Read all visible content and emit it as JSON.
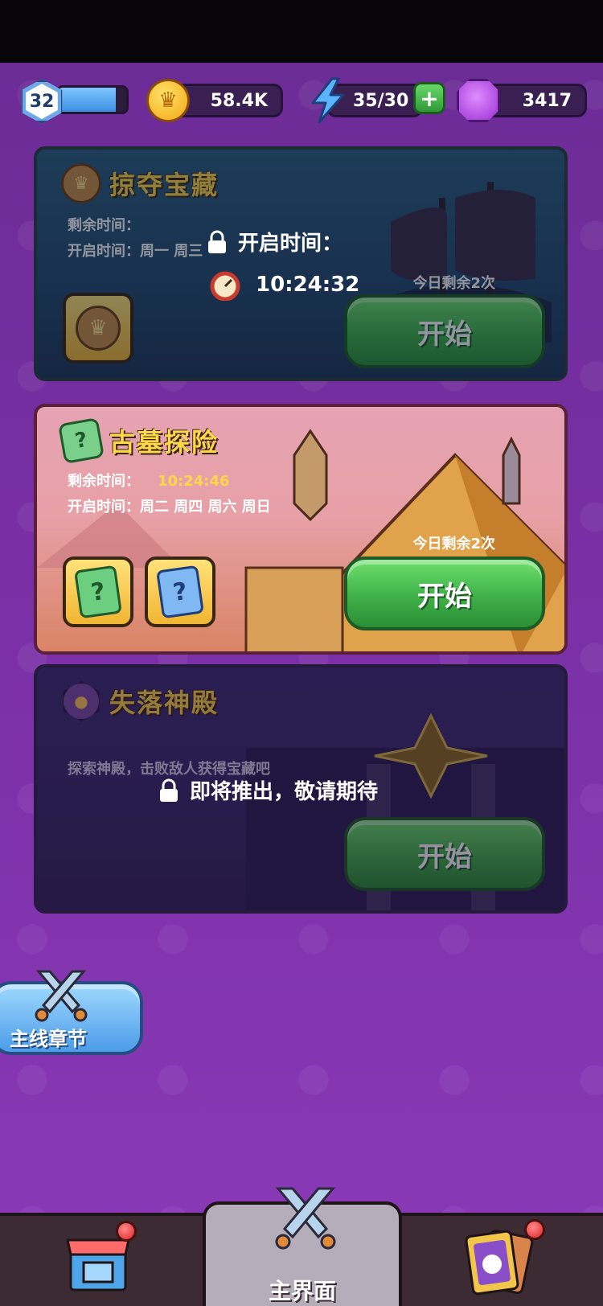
{
  "status": {
    "level": "32",
    "xp_fraction": 0.85,
    "coins": "58.4K",
    "energy": "35/30",
    "gems": "3417"
  },
  "cards": [
    {
      "title": "掠夺宝藏",
      "remaining_label": "剩余时间：",
      "open_label": "开启时间：周一 周三",
      "lock_text": "开启时间：",
      "countdown": "10:24:32",
      "remain_today": "今日剩余2次",
      "start_label": "开始"
    },
    {
      "title": "古墓探险",
      "remaining_label": "剩余时间：",
      "remaining_value": "10:24:46",
      "open_label": "开启时间：周二 周四 周六 周日",
      "remain_today": "今日剩余2次",
      "start_label": "开始"
    },
    {
      "title": "失落神殿",
      "desc": "探索神殿，击败敌人获得宝藏吧",
      "lock_text": "即将推出，敬请期待",
      "start_label": "开始"
    }
  ],
  "side": {
    "main_chapter": "主线章节"
  },
  "nav": {
    "center_label": "主界面"
  }
}
